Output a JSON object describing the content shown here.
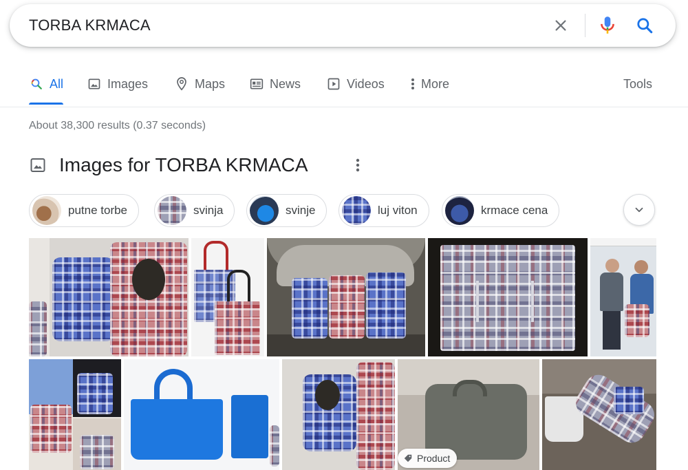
{
  "search": {
    "query": "TORBA KRMACA"
  },
  "tabs": [
    {
      "label": "All",
      "icon": "search-icon",
      "active": true
    },
    {
      "label": "Images",
      "icon": "image-icon"
    },
    {
      "label": "Maps",
      "icon": "map-pin-icon"
    },
    {
      "label": "News",
      "icon": "news-icon"
    },
    {
      "label": "Videos",
      "icon": "play-icon"
    },
    {
      "label": "More",
      "icon": "kebab-icon"
    }
  ],
  "tools_label": "Tools",
  "results": {
    "stats": "About 38,300 results (0.37 seconds)"
  },
  "images_section": {
    "title": "Images for TORBA KRMACA",
    "chips": [
      {
        "label": "putne torbe"
      },
      {
        "label": "svinja"
      },
      {
        "label": "svinje"
      },
      {
        "label": "luj viton"
      },
      {
        "label": "krmace cena"
      }
    ],
    "badge": "Product"
  },
  "colors": {
    "accent": "#1a73e8",
    "mic_blue": "#4285f4",
    "mic_red": "#ea4335",
    "mic_yellow": "#fbbc05",
    "mic_green": "#34a853",
    "text_secondary": "#5f6368"
  }
}
